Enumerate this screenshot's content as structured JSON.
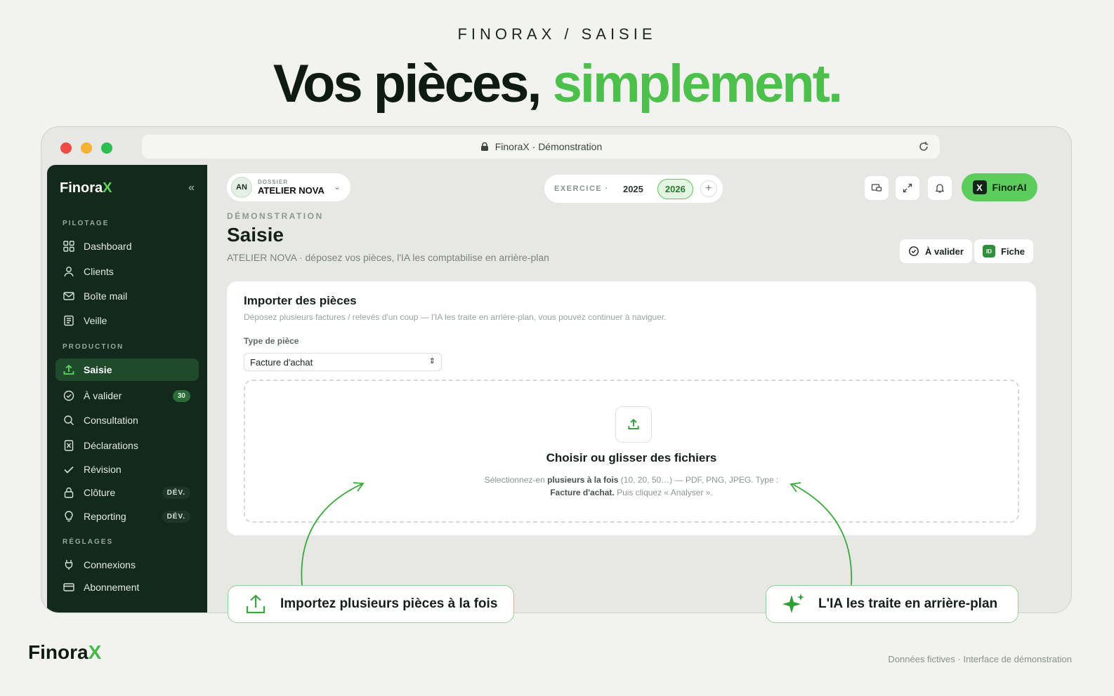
{
  "header": {
    "eyebrow": "FINORAX / SAISIE",
    "title_main": "Vos pièces, ",
    "title_accent": "simplement."
  },
  "browser": {
    "url_label": "FinoraX · Démonstration"
  },
  "sidebar": {
    "brand": "Finora",
    "brand_x": "X",
    "collapse_label": "«",
    "sections": {
      "pilotage": "PILOTAGE",
      "production": "PRODUCTION",
      "reglages": "RÉGLAGES"
    },
    "items": [
      {
        "label": "Dashboard",
        "icon": "grid-icon"
      },
      {
        "label": "Clients",
        "icon": "user-icon"
      },
      {
        "label": "Boîte mail",
        "icon": "mail-icon"
      },
      {
        "label": "Veille",
        "icon": "newspaper-icon"
      },
      {
        "label": "Saisie",
        "icon": "upload-icon",
        "active": true
      },
      {
        "label": "À valider",
        "icon": "check-circle-icon",
        "badge": "30"
      },
      {
        "label": "Consultation",
        "icon": "search-icon"
      },
      {
        "label": "Déclarations",
        "icon": "document-icon"
      },
      {
        "label": "Révision",
        "icon": "check-icon"
      },
      {
        "label": "Clôture",
        "icon": "lock-icon",
        "badge": "DÉV."
      },
      {
        "label": "Reporting",
        "icon": "lightbulb-icon",
        "badge": "DÉV."
      },
      {
        "label": "Connexions",
        "icon": "plug-icon"
      },
      {
        "label": "Abonnement",
        "icon": "card-icon"
      }
    ]
  },
  "topbar": {
    "dossier_initials": "AN",
    "dossier_label": "DOSSIER",
    "dossier_name": "ATELIER NOVA",
    "exercice_label": "EXERCICE ·",
    "years": [
      "2025",
      "2026"
    ],
    "selected_year": "2026",
    "add_label": "+",
    "ai_button": "FinorAI",
    "ai_logo": "X"
  },
  "page": {
    "eyebrow": "DÉMONSTRATION",
    "title": "Saisie",
    "subtitle": "ATELIER NOVA · déposez vos pièces, l'IA les comptabilise en arrière-plan",
    "btn_validate": "À valider",
    "btn_fiche": "Fiche",
    "id_tag": "ID"
  },
  "import_card": {
    "title": "Importer des pièces",
    "subtitle": "Déposez plusieurs factures / relevés d'un coup — l'IA les traite en arrière-plan, vous pouvez continuer à naviguer.",
    "field_label": "Type de pièce",
    "select_value": "Facture d'achat",
    "drop_title": "Choisir ou glisser des fichiers",
    "drop_line1_a": "Sélectionnez-en ",
    "drop_line1_b": "plusieurs à la fois",
    "drop_line1_c": " (10, 20, 50…) — PDF, PNG, JPEG. Type :",
    "drop_line2_a": "Facture d'achat.",
    "drop_line2_b": " Puis cliquez « Analyser »."
  },
  "callouts": {
    "left": "Importez plusieurs pièces à la fois",
    "right": "L'IA les traite en arrière-plan"
  },
  "footer": {
    "brand": "Finora",
    "brand_x": "X",
    "note": "Données fictives · Interface de démonstration"
  },
  "colors": {
    "accent": "#4cc04a",
    "sidebar_bg": "#13291c",
    "active_bg": "#1f4a2c"
  }
}
